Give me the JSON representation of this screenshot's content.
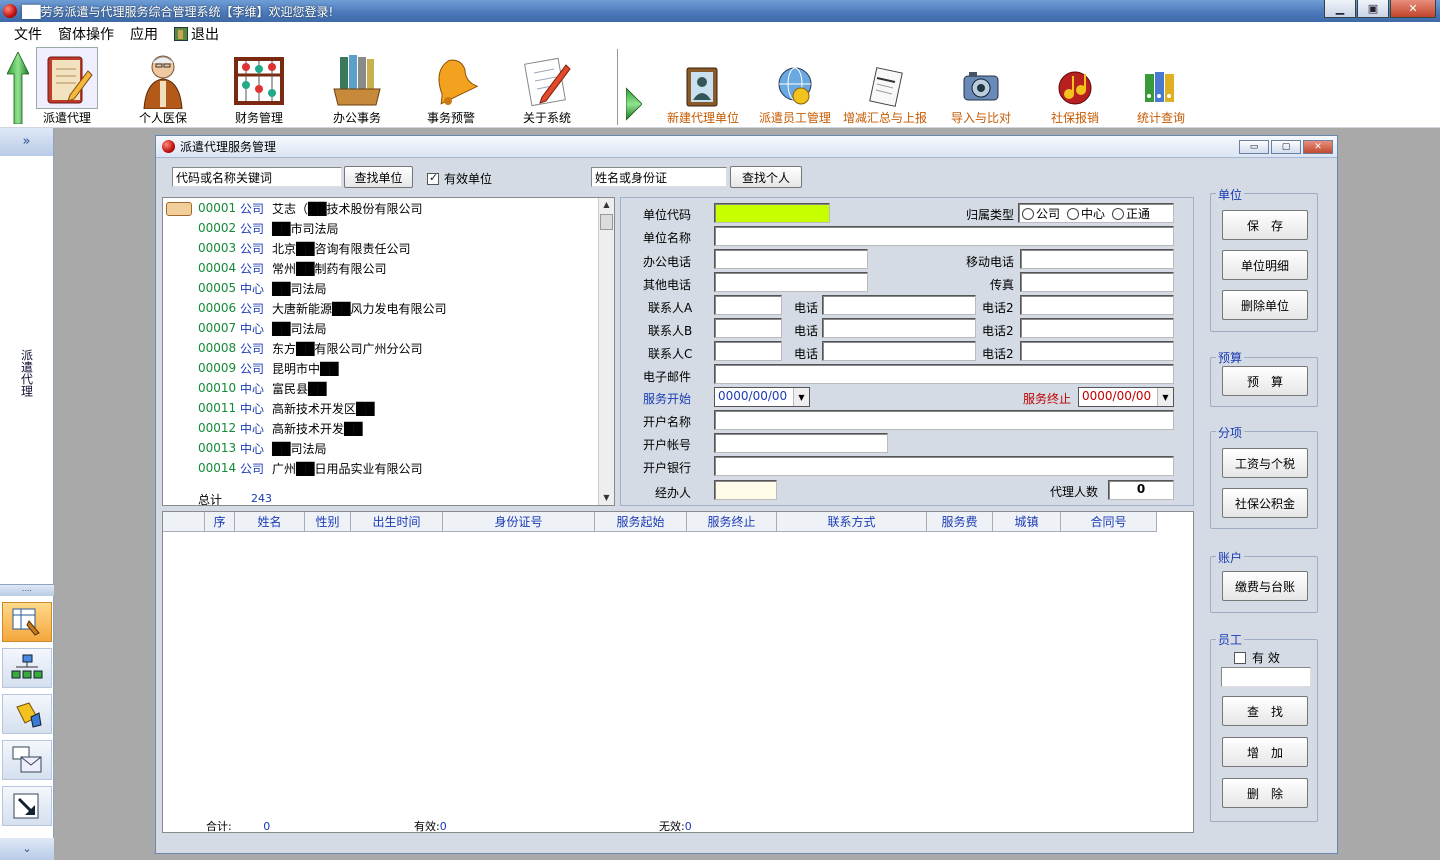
{
  "window": {
    "title": "██劳务派遣与代理服务综合管理系统【李维】欢迎您登录!",
    "minimize_label": "▁",
    "maximize_label": "▣",
    "close_label": "✕"
  },
  "menu": {
    "items": [
      "文件",
      "窗体操作",
      "应用",
      "退出"
    ]
  },
  "toolbar": {
    "tools_left": [
      {
        "label": "派遣代理",
        "icon": "notebook-pencil-icon",
        "selected": true
      },
      {
        "label": "个人医保",
        "icon": "elderly-person-icon"
      },
      {
        "label": "财务管理",
        "icon": "abacus-icon"
      },
      {
        "label": "办公事务",
        "icon": "binders-tray-icon"
      },
      {
        "label": "事务预警",
        "icon": "bell-icon"
      },
      {
        "label": "关于系统",
        "icon": "document-pen-icon"
      }
    ],
    "tools_right": [
      {
        "label": "新建代理单位",
        "icon": "address-book-icon"
      },
      {
        "label": "派遣员工管理",
        "icon": "globe-worker-icon"
      },
      {
        "label": "增减汇总与上报",
        "icon": "notepad-icon"
      },
      {
        "label": "导入与比对",
        "icon": "camera-icon"
      },
      {
        "label": "社保报销",
        "icon": "music-notes-icon"
      },
      {
        "label": "统计查询",
        "icon": "files-icon"
      }
    ]
  },
  "leftnav": {
    "collapse_label": "»",
    "section_label": "派遣代理",
    "grip": "....",
    "footer": "⌄"
  },
  "inner": {
    "title": "派遣代理服务管理",
    "minimize_label": "▭",
    "maximize_label": "▢",
    "close_label": "✕"
  },
  "search": {
    "unit_keyword_value": "代码或名称关键词",
    "find_unit_button": "查找单位",
    "valid_unit_label": "有效单位",
    "valid_unit_checked": true,
    "person_value": "姓名或身份证",
    "find_person_button": "查找个人"
  },
  "unit_list": {
    "rows": [
      {
        "code": "00001",
        "type": "公司",
        "name": "艾志（██技术股份有限公司"
      },
      {
        "code": "00002",
        "type": "公司",
        "name": "██市司法局"
      },
      {
        "code": "00003",
        "type": "公司",
        "name": "北京██咨询有限责任公司"
      },
      {
        "code": "00004",
        "type": "公司",
        "name": "常州██制药有限公司"
      },
      {
        "code": "00005",
        "type": "中心",
        "name": "██司法局"
      },
      {
        "code": "00006",
        "type": "公司",
        "name": "大唐新能源██风力发电有限公司"
      },
      {
        "code": "00007",
        "type": "中心",
        "name": "██司法局"
      },
      {
        "code": "00008",
        "type": "公司",
        "name": "东方██有限公司广州分公司"
      },
      {
        "code": "00009",
        "type": "公司",
        "name": "昆明市中██"
      },
      {
        "code": "00010",
        "type": "中心",
        "name": "富民县██"
      },
      {
        "code": "00011",
        "type": "中心",
        "name": "高新技术开发区██"
      },
      {
        "code": "00012",
        "type": "中心",
        "name": "高新技术开发██"
      },
      {
        "code": "00013",
        "type": "中心",
        "name": "██司法局"
      },
      {
        "code": "00014",
        "type": "公司",
        "name": "广州██日用品实业有限公司"
      }
    ],
    "total_label": "总计",
    "total_value": "243"
  },
  "form": {
    "unit_code_label": "单位代码",
    "belong_type_label": "归属类型",
    "belong_options": [
      "公司",
      "中心",
      "正通"
    ],
    "unit_name_label": "单位名称",
    "office_phone_label": "办公电话",
    "mobile_label": "移动电话",
    "other_phone_label": "其他电话",
    "fax_label": "传真",
    "contact_a_label": "联系人A",
    "contact_b_label": "联系人B",
    "contact_c_label": "联系人C",
    "phone_label": "电话",
    "phone2_label": "电话2",
    "email_label": "电子邮件",
    "service_start_label": "服务开始",
    "service_start_value": "0000/00/00",
    "service_end_label": "服务终止",
    "service_end_value": "0000/00/00",
    "account_name_label": "开户名称",
    "account_no_label": "开户帐号",
    "bank_label": "开户银行",
    "handler_label": "经办人",
    "agent_count_label": "代理人数",
    "agent_count_value": "0",
    "colors": {
      "unit_code_bg": "#c8ff00",
      "handler_bg": "#fffbe8"
    }
  },
  "grid": {
    "columns": [
      "序",
      "姓名",
      "性别",
      "出生时间",
      "身份证号",
      "服务起始",
      "服务终止",
      "联系方式",
      "服务费",
      "城镇",
      "合同号"
    ],
    "total_label": "合计:",
    "total_value": "0",
    "valid_label": "有效:",
    "valid_value": "0",
    "invalid_label": "无效:",
    "invalid_value": "0"
  },
  "side": {
    "unit_group": "单位",
    "save_button": "保　存",
    "unit_detail_button": "单位明细",
    "delete_unit_button": "删除单位",
    "budget_group": "预算",
    "budget_button": "预　算",
    "items_group": "分项",
    "salary_tax_button": "工资与个税",
    "social_fund_button": "社保公积金",
    "account_group": "账户",
    "payment_ledger_button": "缴费与台账",
    "staff_group": "员工",
    "staff_valid_label": "有 效",
    "staff_valid_checked": false,
    "find_button": "查　找",
    "add_button": "增　加",
    "delete_button": "删　除"
  }
}
